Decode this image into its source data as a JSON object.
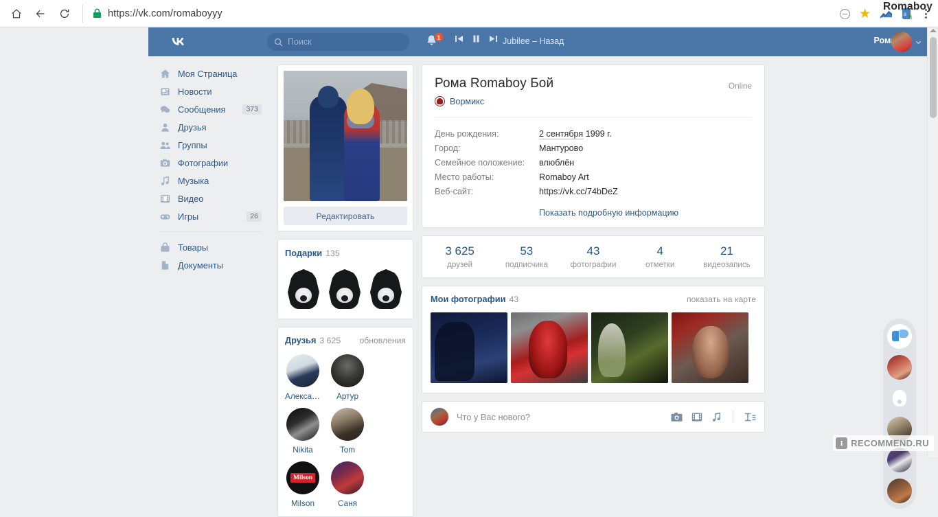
{
  "browser": {
    "url": "https://vk.com/romaboyyy",
    "profile_name": "Romaboy",
    "icons": {
      "home": "home-icon",
      "back": "back-arrow-icon",
      "reload": "reload-icon",
      "lock": "lock-icon",
      "zoom_out": "zoom-minus-icon",
      "bookmark": "star-icon",
      "extension_chart": "chart-extension-icon",
      "extension_translate": "translate-extension-icon",
      "menu": "kebab-menu-icon"
    }
  },
  "vk_header": {
    "logo": "vk-logo",
    "search_placeholder": "Поиск",
    "notifications_count": "1",
    "player": {
      "prev": "prev-track-icon",
      "pause": "pause-icon",
      "next": "next-track-icon",
      "track": "Jubilee – Назад"
    },
    "user_name": "Рома"
  },
  "sidebar": {
    "items": [
      {
        "label": "Моя Страница",
        "icon": "home-icon",
        "count": ""
      },
      {
        "label": "Новости",
        "icon": "news-icon",
        "count": ""
      },
      {
        "label": "Сообщения",
        "icon": "messages-icon",
        "count": "373"
      },
      {
        "label": "Друзья",
        "icon": "friends-icon",
        "count": ""
      },
      {
        "label": "Группы",
        "icon": "groups-icon",
        "count": ""
      },
      {
        "label": "Фотографии",
        "icon": "photos-icon",
        "count": ""
      },
      {
        "label": "Музыка",
        "icon": "music-icon",
        "count": ""
      },
      {
        "label": "Видео",
        "icon": "video-icon",
        "count": ""
      },
      {
        "label": "Игры",
        "icon": "games-icon",
        "count": "26"
      }
    ],
    "items_secondary": [
      {
        "label": "Товары",
        "icon": "goods-icon",
        "count": ""
      },
      {
        "label": "Документы",
        "icon": "documents-icon",
        "count": ""
      }
    ]
  },
  "left_column": {
    "avatar_alt": "profile-photo-couple",
    "edit_button": "Редактировать",
    "gifts": {
      "title": "Подарки",
      "count": "135",
      "items": [
        "gift-dark-hood",
        "gift-dark-hood",
        "gift-dark-hood"
      ]
    },
    "friends": {
      "title": "Друзья",
      "count": "3 625",
      "updates_link": "обновления",
      "list": [
        {
          "name": "Александ..."
        },
        {
          "name": "Артур"
        },
        {
          "name": "Nikita"
        },
        {
          "name": "Tom"
        },
        {
          "name": "Milson"
        },
        {
          "name": "Саня"
        }
      ]
    }
  },
  "profile": {
    "name": "Рома Romaboy Бой",
    "online_status": "Online",
    "badge": {
      "label": "Вормикс",
      "icon": "wormix-badge-icon"
    },
    "info": [
      {
        "key": "День рождения:",
        "value_link": "2 сентября",
        "value_rest": " 1999 г."
      },
      {
        "key": "Город:",
        "value_link": "",
        "value_rest": "Мантурово"
      },
      {
        "key": "Семейное положение:",
        "value_link": "",
        "value_rest": "влюблён"
      },
      {
        "key": "Место работы:",
        "value_link": "",
        "value_rest": "Romaboy Art"
      },
      {
        "key": "Веб-сайт:",
        "value_link": "",
        "value_rest": "https://vk.cc/74bDeZ"
      }
    ],
    "show_more": "Показать подробную информацию",
    "counters": [
      {
        "number": "3 625",
        "label": "друзей"
      },
      {
        "number": "53",
        "label": "подписчика"
      },
      {
        "number": "43",
        "label": "фотографии"
      },
      {
        "number": "4",
        "label": "отметки"
      },
      {
        "number": "21",
        "label": "видеозапись"
      }
    ]
  },
  "photos_block": {
    "title": "Мои фотографии",
    "count": "43",
    "map_link": "показать на карте",
    "thumbs": [
      {
        "alt": "cosplay-photo-blue-night"
      },
      {
        "alt": "cosplay-photo-red-demon"
      },
      {
        "alt": "cosplay-photo-green-forest"
      },
      {
        "alt": "cosplay-photo-red-portrait"
      }
    ]
  },
  "post_box": {
    "placeholder": "Что у Вас нового?",
    "icons": [
      "camera-icon",
      "video-icon",
      "music-icon",
      "text-format-icon"
    ]
  },
  "right_rail": {
    "avatars": [
      {
        "alt": "chat-avatar-logo-blue"
      },
      {
        "alt": "chat-avatar-red-portrait"
      },
      {
        "alt": "chat-avatar-white-dog"
      },
      {
        "alt": "chat-avatar-beige-figure"
      },
      {
        "alt": "chat-avatar-purple-reaper"
      },
      {
        "alt": "chat-avatar-dark-warm"
      }
    ]
  },
  "watermark": {
    "badge": "I",
    "text": "RECOMMEND.RU"
  },
  "colors": {
    "vk_blue": "#4a76a8",
    "link_blue": "#2a5885",
    "page_bg": "#edeef0",
    "badge_red": "#f0542d",
    "wormix_red": "#9b1c1c"
  }
}
